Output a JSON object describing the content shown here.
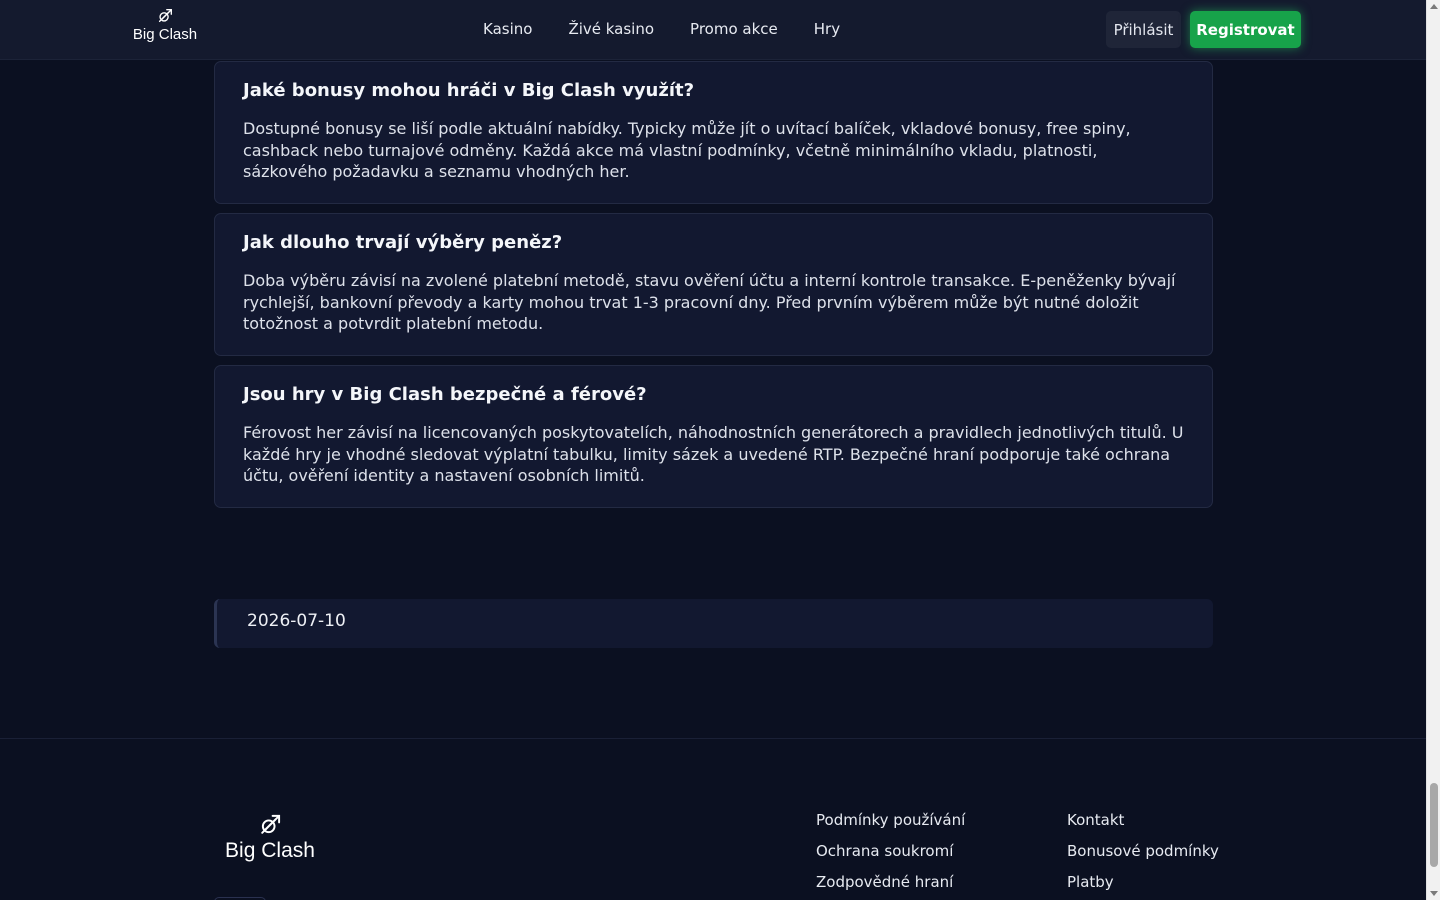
{
  "header": {
    "logo_text": "Big Clash",
    "nav": [
      {
        "label": "Kasino"
      },
      {
        "label": "Živé kasino"
      },
      {
        "label": "Promo akce"
      },
      {
        "label": "Hry"
      }
    ],
    "login_label": "Přihlásit",
    "register_label": "Registrovat"
  },
  "faq": [
    {
      "question": "Jaké bonusy mohou hráči v Big Clash využít?",
      "answer": "Dostupné bonusy se liší podle aktuální nabídky. Typicky může jít o uvítací balíček, vkladové bonusy, free spiny, cashback nebo turnajové odměny. Každá akce má vlastní podmínky, včetně minimálního vkladu, platnosti, sázkového požadavku a seznamu vhodných her."
    },
    {
      "question": "Jak dlouho trvají výběry peněz?",
      "answer": "Doba výběru závisí na zvolené platební metodě, stavu ověření účtu a interní kontrole transakce. E-peněženky bývají rychlejší, bankovní převody a karty mohou trvat 1-3 pracovní dny. Před prvním výběrem může být nutné doložit totožnost a potvrdit platební metodu."
    },
    {
      "question": "Jsou hry v Big Clash bezpečné a férové?",
      "answer": "Férovost her závisí na licencovaných poskytovatelích, náhodnostních generátorech a pravidlech jednotlivých titulů. U každé hry je vhodné sledovat výplatní tabulku, limity sázek a uvedené RTP. Bezpečné hraní podporuje také ochrana účtu, ověření identity a nastavení osobních limitů."
    }
  ],
  "updated_date": "2026-07-10",
  "footer": {
    "logo_text": "Big Clash",
    "col1": [
      {
        "label": "Podmínky používání"
      },
      {
        "label": "Ochrana soukromí"
      },
      {
        "label": "Zodpovědné hraní"
      }
    ],
    "col2": [
      {
        "label": "Kontakt"
      },
      {
        "label": "Bonusové podmínky"
      },
      {
        "label": "Platby"
      }
    ]
  },
  "colors": {
    "background": "#0b1021",
    "header": "#141a2e",
    "card": "#121830",
    "accent_green": "#17a34a"
  }
}
